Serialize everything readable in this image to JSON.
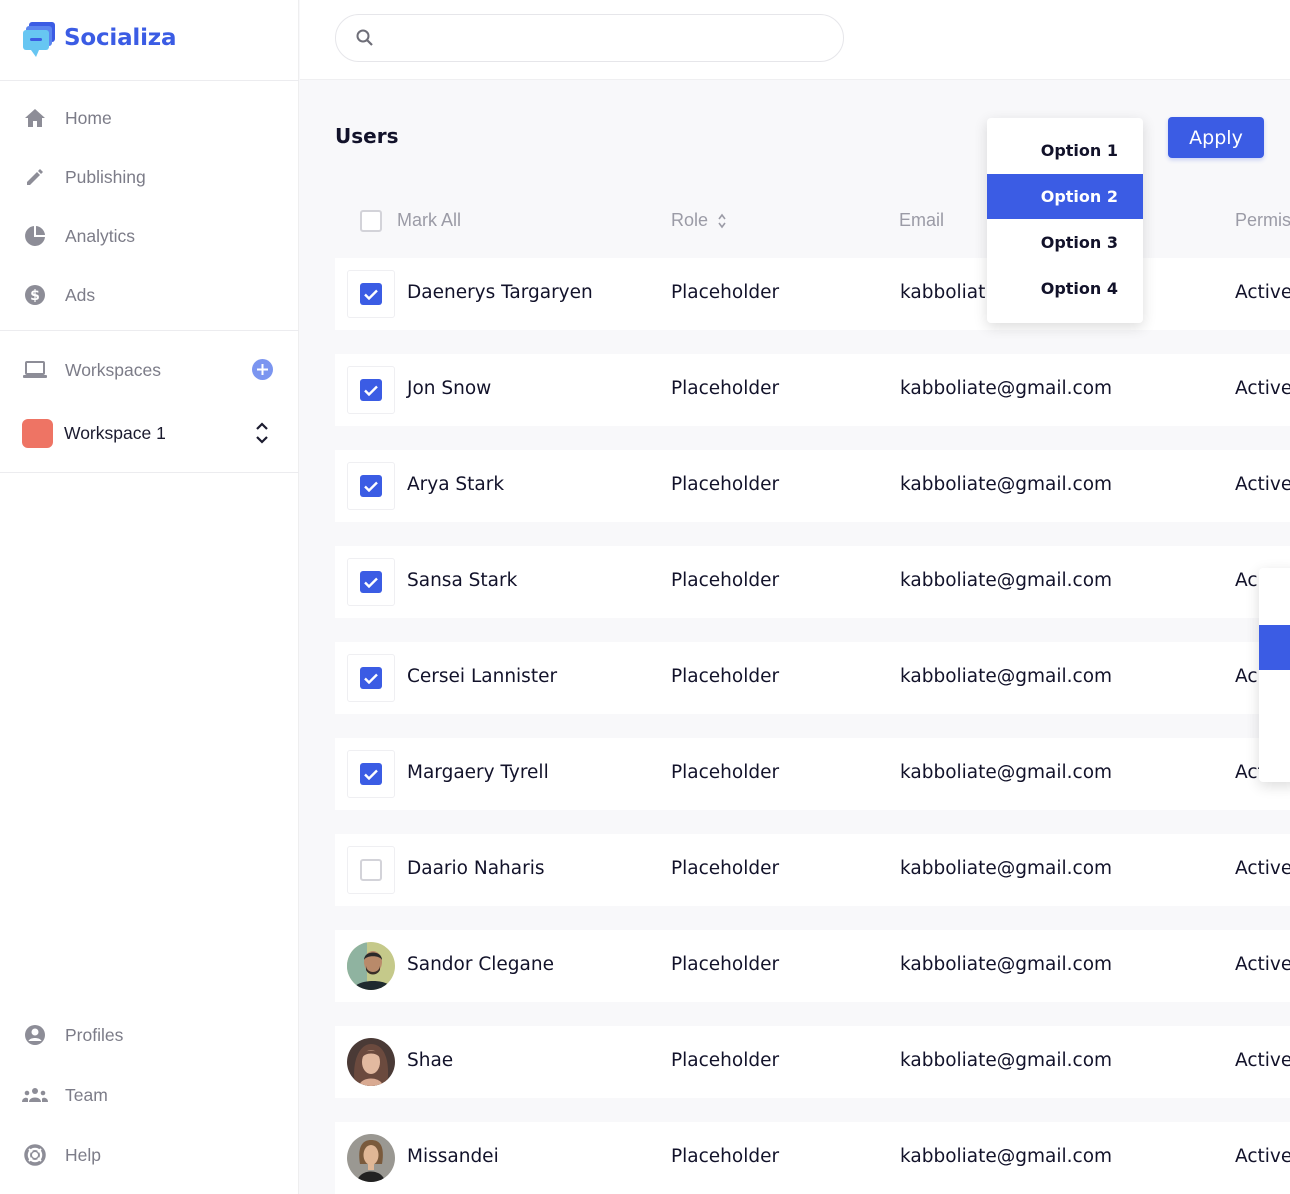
{
  "app": {
    "name": "Socializa",
    "brand_color": "#3b5ce4"
  },
  "sidebar": {
    "nav": [
      {
        "label": "Home",
        "icon": "home-icon"
      },
      {
        "label": "Publishing",
        "icon": "pencil-icon"
      },
      {
        "label": "Analytics",
        "icon": "pie-chart-icon"
      },
      {
        "label": "Ads",
        "icon": "dollar-icon"
      }
    ],
    "workspaces_label": "Workspaces",
    "workspace": {
      "name": "Workspace 1",
      "color": "#ee7464"
    },
    "bottom_nav": [
      {
        "label": "Profiles",
        "icon": "profile-icon"
      },
      {
        "label": "Team",
        "icon": "team-icon"
      },
      {
        "label": "Help",
        "icon": "help-icon"
      }
    ]
  },
  "search": {
    "placeholder": "",
    "value": ""
  },
  "page": {
    "title": "Users",
    "apply_label": "Apply"
  },
  "table": {
    "mark_all_label": "Mark All",
    "columns": {
      "role": "Role",
      "email": "Email",
      "permissions": "Permis"
    },
    "rows": [
      {
        "name": "Daenerys Targaryen",
        "role": "Placeholder",
        "email": "kabboliat",
        "status": "Active",
        "lead": "checkbox",
        "checked": true
      },
      {
        "name": "Jon Snow",
        "role": "Placeholder",
        "email": "kabboliate@gmail.com",
        "status": "Active",
        "lead": "checkbox",
        "checked": true
      },
      {
        "name": "Arya Stark",
        "role": "Placeholder",
        "email": "kabboliate@gmail.com",
        "status": "Active",
        "lead": "checkbox",
        "checked": true
      },
      {
        "name": "Sansa Stark",
        "role": "Placeholder",
        "email": "kabboliate@gmail.com",
        "status": "Ac",
        "lead": "checkbox",
        "checked": true
      },
      {
        "name": "Cersei Lannister",
        "role": "Placeholder",
        "email": "kabboliate@gmail.com",
        "status": "Ac",
        "lead": "checkbox",
        "checked": true
      },
      {
        "name": "Margaery Tyrell",
        "role": "Placeholder",
        "email": "kabboliate@gmail.com",
        "status": "Active",
        "lead": "checkbox",
        "checked": true
      },
      {
        "name": "Daario Naharis",
        "role": "Placeholder",
        "email": "kabboliate@gmail.com",
        "status": "Active",
        "lead": "checkbox",
        "checked": false
      },
      {
        "name": "Sandor Clegane",
        "role": "Placeholder",
        "email": "kabboliate@gmail.com",
        "status": "Active",
        "lead": "avatar"
      },
      {
        "name": "Shae",
        "role": "Placeholder",
        "email": "kabboliate@gmail.com",
        "status": "Active",
        "lead": "avatar"
      },
      {
        "name": "Missandei",
        "role": "Placeholder",
        "email": "kabboliate@gmail.com",
        "status": "Active",
        "lead": "avatar"
      }
    ]
  },
  "dropdown": {
    "options": [
      "Option 1",
      "Option 2",
      "Option 3",
      "Option 4"
    ],
    "selected": "Option 2"
  }
}
